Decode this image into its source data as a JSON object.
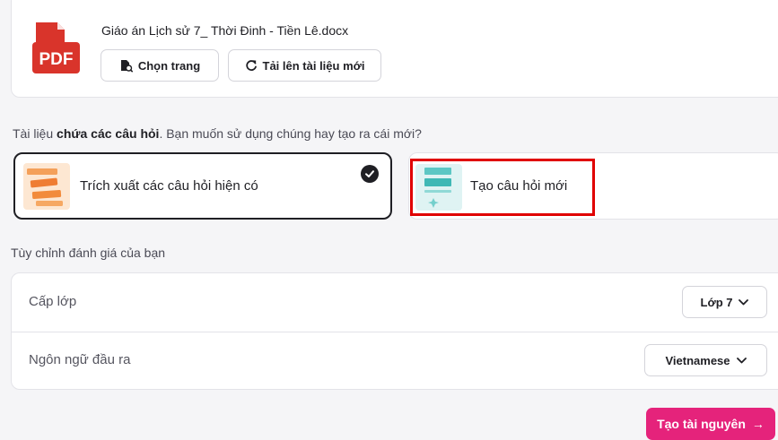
{
  "file": {
    "name": "Giáo án Lịch sử 7_ Thời Đinh - Tiền Lê.docx",
    "badge": "PDF",
    "select_pages_label": "Chọn trang",
    "upload_new_label": "Tải lên tài liệu mới"
  },
  "question_source": {
    "prompt_prefix": "Tài liệu ",
    "prompt_bold": "chứa các câu hỏi",
    "prompt_suffix": ". Bạn muốn sử dụng chúng hay tạo ra cái mới?",
    "options": [
      {
        "label": "Trích xuất các câu hỏi hiện có",
        "selected": true
      },
      {
        "label": "Tạo câu hỏi mới",
        "selected": false
      }
    ]
  },
  "customize": {
    "heading": "Tùy chỉnh đánh giá của bạn",
    "grade_label": "Cấp lớp",
    "grade_value": "Lớp 7",
    "language_label": "Ngôn ngữ đầu ra",
    "language_value": "Vietnamese"
  },
  "actions": {
    "create_label": "Tạo tài nguyên",
    "create_arrow": "→"
  },
  "colors": {
    "pdf_red": "#d9342b",
    "primary_pink": "#e5237b",
    "highlight_red": "#e00000"
  }
}
